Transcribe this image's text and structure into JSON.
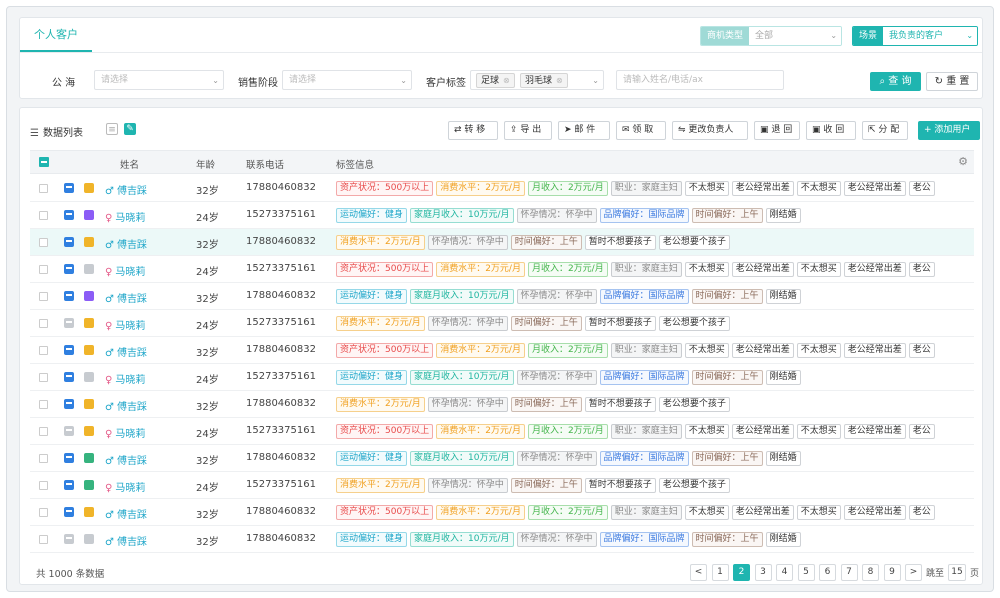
{
  "tab": "个人客户",
  "selectors": {
    "opp_type": {
      "label": "商机类型",
      "value": "全部"
    },
    "scene": {
      "label": "场景",
      "value": "我负责的客户"
    }
  },
  "filters": {
    "sea_label": "公 海",
    "sea_placeholder": "请选择",
    "stage_label": "销售阶段",
    "stage_placeholder": "请选择",
    "tag_label": "客户标签",
    "tags": [
      "足球",
      "羽毛球"
    ],
    "search_placeholder": "请输入姓名/电话/ax",
    "query_label": "查 询",
    "reset_label": "重 置"
  },
  "toolbar": {
    "list_title": "数据列表",
    "buttons": [
      "转 移",
      "导 出",
      "邮 件",
      "领 取",
      "更改负责人",
      "退 回",
      "收 回",
      "分 配",
      "添加用户"
    ]
  },
  "columns": [
    "姓名",
    "年龄",
    "联系电话",
    "标签信息"
  ],
  "tag_groups": {
    "A": [
      {
        "text": "资产状况：500万以上",
        "c": "t-red"
      },
      {
        "text": "消费水平：2万元/月",
        "c": "t-orange"
      },
      {
        "text": "月收入：2万元/月",
        "c": "t-green"
      },
      {
        "text": "职业：家庭主妇",
        "c": "t-grey"
      },
      {
        "text": "不太想买",
        "c": "t-plain"
      },
      {
        "text": "老公经常出差",
        "c": "t-plain"
      },
      {
        "text": "不太想买",
        "c": "t-plain"
      },
      {
        "text": "老公经常出差",
        "c": "t-plain"
      },
      {
        "text": "老公",
        "c": "t-plain"
      }
    ],
    "B": [
      {
        "text": "运动偏好：健身",
        "c": "t-cyan"
      },
      {
        "text": "家庭月收入：10万元/月",
        "c": "t-teal"
      },
      {
        "text": "怀孕情况：怀孕中",
        "c": "t-grey"
      },
      {
        "text": "品牌偏好：国际品牌",
        "c": "t-blue"
      },
      {
        "text": "时间偏好：上午",
        "c": "t-brown"
      },
      {
        "text": "刚结婚",
        "c": "t-plain"
      }
    ],
    "C": [
      {
        "text": "消费水平：2万元/月",
        "c": "t-orange"
      },
      {
        "text": "怀孕情况：怀孕中",
        "c": "t-grey"
      },
      {
        "text": "时间偏好：上午",
        "c": "t-brown"
      },
      {
        "text": "暂时不想要孩子",
        "c": "t-plain"
      },
      {
        "text": "老公想要个孩子",
        "c": "t-plain"
      }
    ]
  },
  "rows": [
    {
      "name": "傅吉踩",
      "g": "m",
      "age": "32岁",
      "phone": "17880460832",
      "tags": "A",
      "i1": "blue",
      "i2": "gold"
    },
    {
      "name": "马晓莉",
      "g": "f",
      "age": "24岁",
      "phone": "15273375161",
      "tags": "B",
      "i1": "blue",
      "i2": "purple"
    },
    {
      "name": "傅吉踩",
      "g": "m",
      "age": "32岁",
      "phone": "17880460832",
      "tags": "C",
      "i1": "blue",
      "i2": "gold",
      "hl": true
    },
    {
      "name": "马晓莉",
      "g": "f",
      "age": "24岁",
      "phone": "15273375161",
      "tags": "A",
      "i1": "blue",
      "i2": "grey"
    },
    {
      "name": "傅吉踩",
      "g": "m",
      "age": "32岁",
      "phone": "17880460832",
      "tags": "B",
      "i1": "blue",
      "i2": "purple"
    },
    {
      "name": "马晓莉",
      "g": "f",
      "age": "24岁",
      "phone": "15273375161",
      "tags": "C",
      "i1": "grey",
      "i2": "gold"
    },
    {
      "name": "傅吉踩",
      "g": "m",
      "age": "32岁",
      "phone": "17880460832",
      "tags": "A",
      "i1": "blue",
      "i2": "gold"
    },
    {
      "name": "马晓莉",
      "g": "f",
      "age": "24岁",
      "phone": "15273375161",
      "tags": "B",
      "i1": "blue",
      "i2": "grey"
    },
    {
      "name": "傅吉踩",
      "g": "m",
      "age": "32岁",
      "phone": "17880460832",
      "tags": "C",
      "i1": "blue",
      "i2": "gold"
    },
    {
      "name": "马晓莉",
      "g": "f",
      "age": "24岁",
      "phone": "15273375161",
      "tags": "A",
      "i1": "grey",
      "i2": "gold"
    },
    {
      "name": "傅吉踩",
      "g": "m",
      "age": "32岁",
      "phone": "17880460832",
      "tags": "B",
      "i1": "blue",
      "i2": "green"
    },
    {
      "name": "马晓莉",
      "g": "f",
      "age": "24岁",
      "phone": "15273375161",
      "tags": "C",
      "i1": "blue",
      "i2": "green"
    },
    {
      "name": "傅吉踩",
      "g": "m",
      "age": "32岁",
      "phone": "17880460832",
      "tags": "A",
      "i1": "blue",
      "i2": "gold"
    },
    {
      "name": "傅吉踩",
      "g": "m",
      "age": "32岁",
      "phone": "17880460832",
      "tags": "B",
      "i1": "grey",
      "i2": "grey"
    }
  ],
  "pagination": {
    "total": "共 1000 条数据",
    "prev": "<",
    "next": ">",
    "pages": [
      "1",
      "2",
      "3",
      "4",
      "5",
      "6",
      "7",
      "8",
      "9"
    ],
    "active": "2",
    "jump_label": "跳至",
    "jump_value": "15",
    "jump_suffix": "页"
  }
}
